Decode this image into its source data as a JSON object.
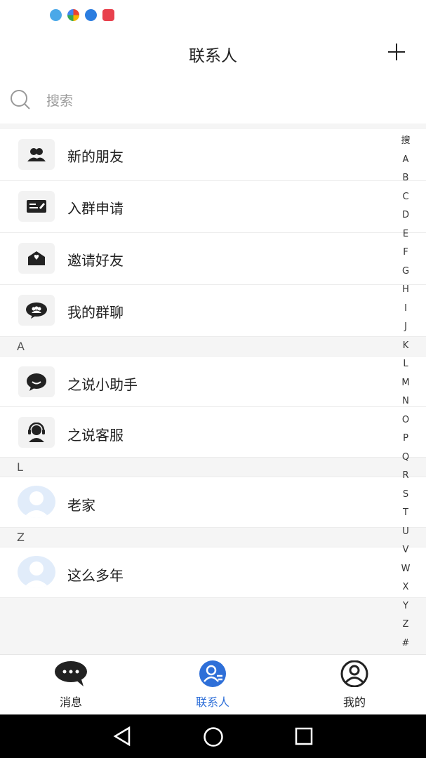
{
  "status_bar": {
    "icons": [
      "cloud-icon",
      "pinwheel-icon",
      "globe-icon",
      "book-icon"
    ]
  },
  "header": {
    "title": "联系人",
    "add_icon": "plus-icon"
  },
  "search": {
    "placeholder": "搜索"
  },
  "menu_items": [
    {
      "label": "新的朋友",
      "icon": "new-friends-icon"
    },
    {
      "label": "入群申请",
      "icon": "group-request-icon"
    },
    {
      "label": "邀请好友",
      "icon": "invite-friends-icon"
    },
    {
      "label": "我的群聊",
      "icon": "my-groups-icon"
    }
  ],
  "sections": [
    {
      "letter": "A",
      "contacts": [
        {
          "name": "之说小助手",
          "icon": "assistant-icon"
        },
        {
          "name": "之说客服",
          "icon": "customer-service-icon"
        }
      ]
    },
    {
      "letter": "L",
      "contacts": [
        {
          "name": "老家",
          "icon": "avatar-icon"
        }
      ]
    },
    {
      "letter": "Z",
      "contacts": [
        {
          "name": "这么多年",
          "icon": "avatar-icon"
        }
      ]
    }
  ],
  "index_letters": [
    "搜",
    "A",
    "B",
    "C",
    "D",
    "E",
    "F",
    "G",
    "H",
    "I",
    "J",
    "K",
    "L",
    "M",
    "N",
    "O",
    "P",
    "Q",
    "R",
    "S",
    "T",
    "U",
    "V",
    "W",
    "X",
    "Y",
    "Z",
    "#"
  ],
  "tabs": [
    {
      "label": "消息",
      "icon": "message-icon",
      "active": false
    },
    {
      "label": "联系人",
      "icon": "contacts-icon",
      "active": true
    },
    {
      "label": "我的",
      "icon": "profile-icon",
      "active": false
    }
  ],
  "colors": {
    "accent": "#2e6fd8",
    "icon_dark": "#222222",
    "avatar_bg": "#e1ecfa"
  }
}
